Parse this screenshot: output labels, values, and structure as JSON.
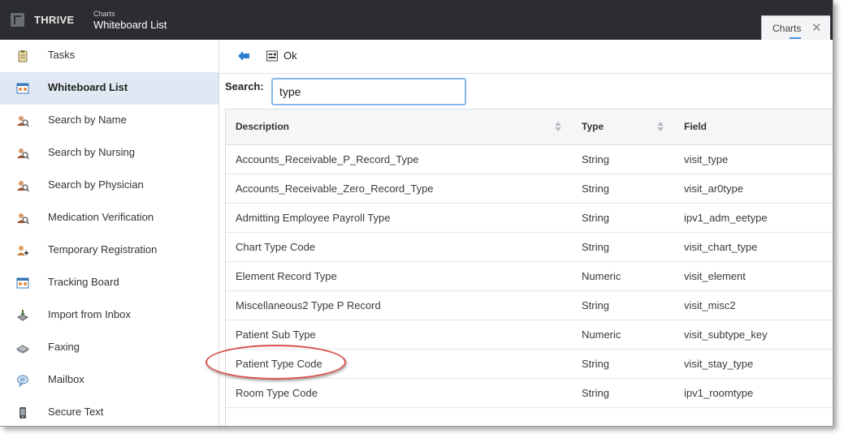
{
  "header": {
    "brand": "THRIVE",
    "section": "Charts",
    "title": "Whiteboard List",
    "tab_label": "Charts",
    "tab_close": "✕"
  },
  "sidebar": {
    "items": [
      {
        "label": "Tasks",
        "icon": "clipboard-icon"
      },
      {
        "label": "Whiteboard List",
        "icon": "whiteboard-icon",
        "active": true
      },
      {
        "label": "Search by Name",
        "icon": "people-search-icon"
      },
      {
        "label": "Search by Nursing",
        "icon": "people-search-icon"
      },
      {
        "label": "Search by Physician",
        "icon": "people-search-icon"
      },
      {
        "label": "Medication Verification",
        "icon": "people-search-icon"
      },
      {
        "label": "Temporary Registration",
        "icon": "person-add-icon"
      },
      {
        "label": "Tracking Board",
        "icon": "whiteboard-icon"
      },
      {
        "label": "Import from Inbox",
        "icon": "inbox-import-icon"
      },
      {
        "label": "Faxing",
        "icon": "fax-icon"
      },
      {
        "label": "Mailbox",
        "icon": "mailbox-icon"
      },
      {
        "label": "Secure Text",
        "icon": "phone-icon"
      }
    ]
  },
  "toolbar": {
    "ok_label": "Ok"
  },
  "search": {
    "label": "Search:",
    "value": "type"
  },
  "table": {
    "columns": [
      "Description",
      "Type",
      "Field"
    ],
    "rows": [
      [
        "Accounts_Receivable_P_Record_Type",
        "String",
        "visit_type"
      ],
      [
        "Accounts_Receivable_Zero_Record_Type",
        "String",
        "visit_ar0type"
      ],
      [
        "Admitting Employee Payroll Type",
        "String",
        "ipv1_adm_eetype"
      ],
      [
        "Chart Type Code",
        "String",
        "visit_chart_type"
      ],
      [
        "Element Record Type",
        "Numeric",
        "visit_element"
      ],
      [
        "Miscellaneous2 Type P Record",
        "String",
        "visit_misc2"
      ],
      [
        "Patient Sub Type",
        "Numeric",
        "visit_subtype_key"
      ],
      [
        "Patient Type Code",
        "String",
        "visit_stay_type"
      ],
      [
        "Room Type Code",
        "String",
        "ipv1_roomtype"
      ]
    ]
  },
  "colors": {
    "topbar": "#2b2d30",
    "active_item": "#dfe8f3",
    "accent": "#4a90d9",
    "highlight": "#d9534f"
  }
}
